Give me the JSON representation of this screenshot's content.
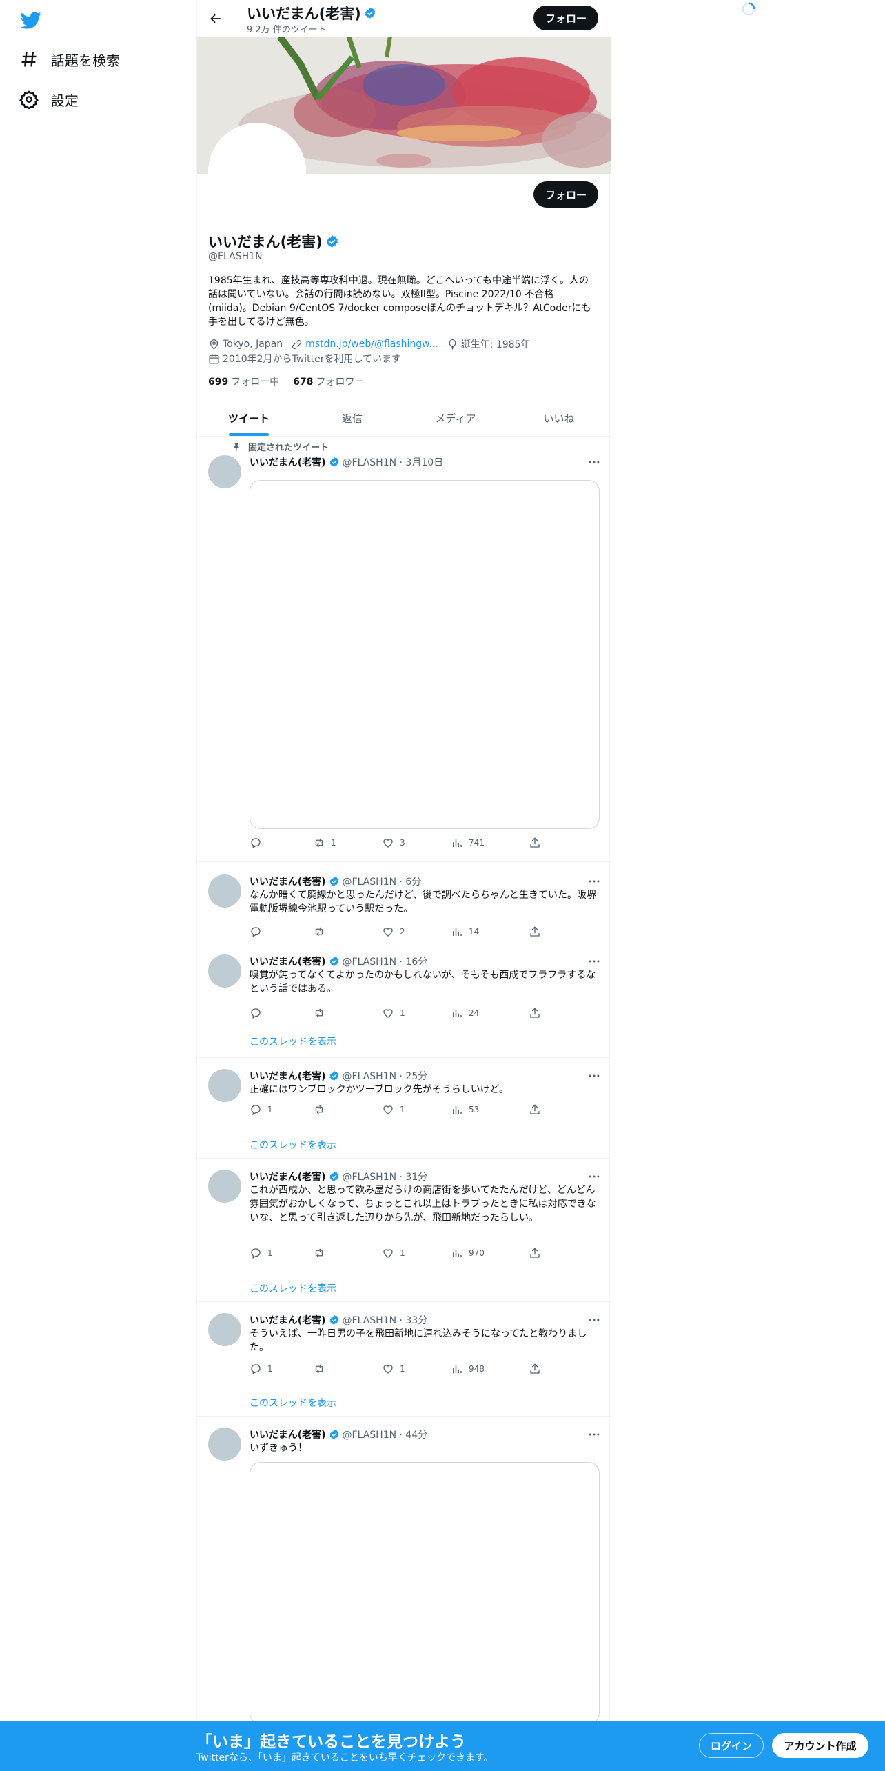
{
  "nav": {
    "explore_label": "話題を検索",
    "settings_label": "設定"
  },
  "header": {
    "name": "いいだまん(老害)",
    "tweet_count": "9.2万 件のツイート",
    "follow_label": "フォロー"
  },
  "profile": {
    "name": "いいだまん(老害)",
    "handle": "@FLASH1N",
    "follow_label": "フォロー",
    "bio": "1985年生まれ、産技高等専攻科中退。現在無職。どこへいっても中途半端に浮く。人の話は聞いていない。会話の行間は読めない。双極II型。Piscine 2022/10 不合格(miida)。Debian 9/CentOS 7/docker composeほんのチョットデキル？AtCoderにも手を出してるけど無色。",
    "location": "Tokyo, Japan",
    "link": "mstdn.jp/web/@flashingw...",
    "birthday": "誕生年: 1985年",
    "joined": "2010年2月からTwitterを利用しています",
    "following_count": "699",
    "following_label": "フォロー中",
    "followers_count": "678",
    "followers_label": "フォロワー"
  },
  "tabs": [
    "ツイート",
    "返信",
    "メディア",
    "いいね"
  ],
  "pinned_label": "固定されたツイート",
  "show_thread_label": "このスレッドを表示",
  "tweets": [
    {
      "name": "いいだまん(老害)",
      "meta": "@FLASH1N · 3月10日",
      "text": "",
      "reply": "",
      "retweet": "1",
      "like": "3",
      "views": "741"
    },
    {
      "name": "いいだまん(老害)",
      "meta": "@FLASH1N · 6分",
      "text": "なんか暗くて廃線かと思ったんだけど、後で調べたらちゃんと生きていた。阪堺電軌阪堺線今池駅っていう駅だった。",
      "reply": "",
      "retweet": "",
      "like": "2",
      "views": "14"
    },
    {
      "name": "いいだまん(老害)",
      "meta": "@FLASH1N · 16分",
      "text": "嗅覚が鈍ってなくてよかったのかもしれないが、そもそも西成でフラフラするなという話ではある。",
      "reply": "",
      "retweet": "",
      "like": "1",
      "views": "24"
    },
    {
      "name": "いいだまん(老害)",
      "meta": "@FLASH1N · 25分",
      "text": "正確にはワンブロックかツーブロック先がそうらしいけど。",
      "reply": "1",
      "retweet": "",
      "like": "1",
      "views": "53"
    },
    {
      "name": "いいだまん(老害)",
      "meta": "@FLASH1N · 31分",
      "text": "これが西成か、と思って飲み屋だらけの商店街を歩いてたたんだけど、どんどん雰囲気がおかしくなって、ちょっとこれ以上はトラブったときに私は対応できないな、と思って引き返した辺りから先が、飛田新地だったらしい。",
      "reply": "1",
      "retweet": "",
      "like": "1",
      "views": "970"
    },
    {
      "name": "いいだまん(老害)",
      "meta": "@FLASH1N · 33分",
      "text": "そういえば、一昨日男の子を飛田新地に連れ込みそうになってたと教わりました。",
      "reply": "1",
      "retweet": "",
      "like": "1",
      "views": "948"
    },
    {
      "name": "いいだまん(老害)",
      "meta": "@FLASH1N · 44分",
      "text": "いずきゅう！",
      "reply": "",
      "retweet": "",
      "like": "",
      "views": ""
    }
  ],
  "bottom_bar": {
    "title": "「いま」起きていることを見つけよう",
    "subtitle": "Twitterなら、「いま」起きていることをいち早くチェックできます。",
    "login_label": "ログイン",
    "signup_label": "アカウント作成"
  },
  "colors": {
    "accent": "#1d9bf0",
    "text": "#0f1419",
    "muted": "#536471"
  }
}
